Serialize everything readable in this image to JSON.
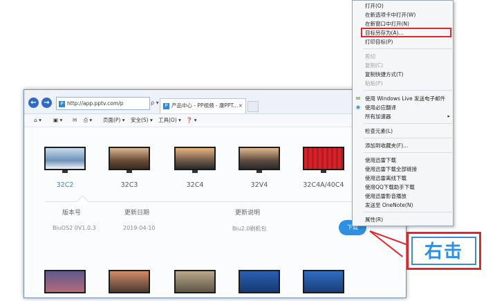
{
  "browser": {
    "address": "http://app.pptv.com/p",
    "address_tools": "ρ ▾ C",
    "tab_title": "产品中心 - PP视频 - 康PPT...",
    "tab_close": "×",
    "back_glyph": "←",
    "forward_glyph": "→",
    "pp_glyph": "P"
  },
  "command_bar": {
    "home": "⌂ ▾",
    "feeds": "▣ ▾",
    "mail": "✉",
    "print": "⎙ ▾",
    "page": "页面(P) ▾",
    "safety": "安全(S) ▾",
    "tools": "工具(O) ▾",
    "help": "❓ ▾"
  },
  "products": [
    {
      "name": "32C2",
      "active": true
    },
    {
      "name": "32C3",
      "active": false
    },
    {
      "name": "32C4",
      "active": false
    },
    {
      "name": "32V4",
      "active": false
    },
    {
      "name": "32C4A/40C4",
      "active": false
    }
  ],
  "details": {
    "headers": {
      "version": "版本号",
      "date": "更新日期",
      "notes": "更新说明"
    },
    "values": {
      "version": "BiuOS2 0V1.0.3",
      "date": "2019-04-10",
      "notes": "Biu2.0刷机包"
    },
    "download_label": "下载"
  },
  "context_menu": {
    "items": [
      {
        "label": "打开(O)",
        "disabled": false,
        "icon": ""
      },
      {
        "label": "在新选项卡中打开(W)",
        "disabled": false,
        "icon": ""
      },
      {
        "label": "在新窗口中打开(N)",
        "disabled": false,
        "icon": ""
      },
      {
        "label": "目标另存为(A)...",
        "disabled": false,
        "icon": ""
      },
      {
        "label": "打印目标(P)",
        "disabled": false,
        "icon": ""
      },
      {
        "label": "剪切",
        "disabled": true,
        "icon": ""
      },
      {
        "label": "复制(C)",
        "disabled": true,
        "icon": ""
      },
      {
        "label": "复制快捷方式(T)",
        "disabled": false,
        "icon": ""
      },
      {
        "label": "粘贴(P)",
        "disabled": true,
        "icon": ""
      },
      {
        "label": "使用 Windows Live 发送电子邮件",
        "disabled": false,
        "icon": "mail-icon"
      },
      {
        "label": "使用必应翻译",
        "disabled": false,
        "icon": "translate-icon"
      },
      {
        "label": "所有加速器",
        "disabled": false,
        "icon": "",
        "submenu": "▸"
      },
      {
        "label": "检查元素(L)",
        "disabled": false,
        "icon": ""
      },
      {
        "label": "添加到收藏夹(F)...",
        "disabled": false,
        "icon": ""
      },
      {
        "label": "使用迅雷下载",
        "disabled": false,
        "icon": ""
      },
      {
        "label": "使用迅雷下载全部链接",
        "disabled": false,
        "icon": ""
      },
      {
        "label": "使用迅雷离线下载",
        "disabled": false,
        "icon": ""
      },
      {
        "label": "使用QQ下载助手下载",
        "disabled": false,
        "icon": ""
      },
      {
        "label": "使用迅雷影音播放",
        "disabled": false,
        "icon": ""
      },
      {
        "label": "发送至 OneNote(N)",
        "disabled": false,
        "icon": ""
      },
      {
        "label": "属性(R)",
        "disabled": false,
        "icon": ""
      }
    ],
    "highlighted_item": "目标另存为(A)..."
  },
  "callout": {
    "text": "右击"
  },
  "colors": {
    "accent": "#2e8fe3",
    "highlight": "#e0272d"
  }
}
